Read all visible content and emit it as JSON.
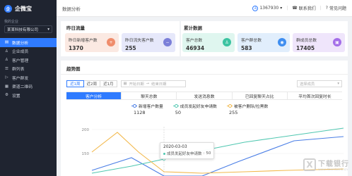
{
  "app": {
    "name": "企微宝",
    "logo_char": "企"
  },
  "sidebar": {
    "company_caption": "我的企业",
    "company_value": "某某科技有限公司",
    "items": [
      {
        "label": "数据分析",
        "icon": "▤",
        "active": true
      },
      {
        "label": "企业成员",
        "icon": "♙"
      },
      {
        "label": "客户管理",
        "icon": "♙"
      },
      {
        "label": "群列表",
        "icon": "☰"
      },
      {
        "label": "客户群发",
        "icon": "▷"
      },
      {
        "label": "渠道二维码",
        "icon": "▦"
      },
      {
        "label": "设置",
        "icon": "⚙"
      }
    ]
  },
  "header": {
    "title": "数据分析",
    "user": "1367930",
    "contact": "联系我们",
    "faq": "常见问题"
  },
  "yesterday": {
    "title": "昨日流量",
    "stats": [
      {
        "label": "昨日新增客户数",
        "value": "1370",
        "color": "#ef8d6c",
        "bg": "#fbe9e2"
      },
      {
        "label": "昨日流失客户数",
        "value": "255",
        "color": "#7b7fd8",
        "bg": "#e6e8fa"
      }
    ]
  },
  "cumulative": {
    "title": "累计数据",
    "stats": [
      {
        "label": "客户总数",
        "value": "46934",
        "color": "#3cc3a1",
        "bg": "#dff6ef"
      },
      {
        "label": "客户群总数",
        "value": "583",
        "color": "#3f8ef0",
        "bg": "#e1eefc"
      },
      {
        "label": "群成员总数",
        "value": "17405",
        "color": "#a36ee8",
        "bg": "#efe5fb"
      }
    ]
  },
  "trend": {
    "title": "趋势图",
    "ranges": [
      "近1周",
      "近2周",
      "近1月"
    ],
    "date_start_placeholder": "开始日期",
    "date_arrow": "→",
    "date_end_placeholder": "结束日期",
    "employee_placeholder": "选择成员",
    "tabs": [
      "客户分析",
      "聊天总数",
      "发送消息数",
      "已回复聊天占比",
      "平均首次回复时长"
    ]
  },
  "chart_data": {
    "type": "line",
    "series": [
      {
        "name": "新增客户数量",
        "total": "1128",
        "color": "#4a7ee6"
      },
      {
        "name": "成员发起好友申请数",
        "total": "50",
        "color": "#4fc7b0"
      },
      {
        "name": "被客户删除/拉黑数",
        "total": "255",
        "color": "#f2b84b"
      }
    ],
    "y_ticks": [
      "200",
      "150"
    ],
    "tooltip": {
      "date": "2020-03-03",
      "series": "成员发起好友申请数",
      "value": "50"
    }
  },
  "watermark": {
    "mark": "X",
    "text": "下载银行",
    "url": "www.downbank.cn"
  }
}
